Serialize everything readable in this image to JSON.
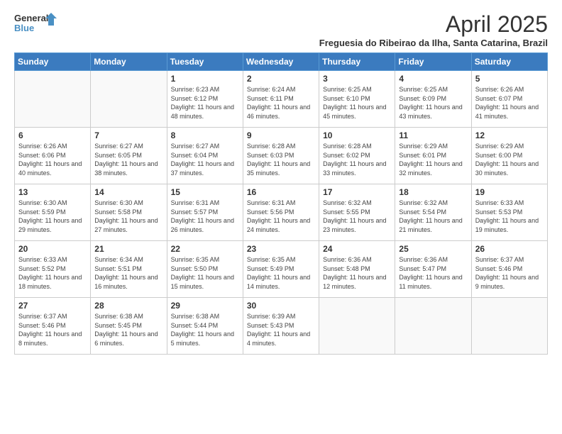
{
  "header": {
    "logo_line1": "General",
    "logo_line2": "Blue",
    "month_title": "April 2025",
    "subtitle": "Freguesia do Ribeirao da Ilha, Santa Catarina, Brazil"
  },
  "weekdays": [
    "Sunday",
    "Monday",
    "Tuesday",
    "Wednesday",
    "Thursday",
    "Friday",
    "Saturday"
  ],
  "weeks": [
    [
      {
        "day": "",
        "sunrise": "",
        "sunset": "",
        "daylight": ""
      },
      {
        "day": "",
        "sunrise": "",
        "sunset": "",
        "daylight": ""
      },
      {
        "day": "1",
        "sunrise": "Sunrise: 6:23 AM",
        "sunset": "Sunset: 6:12 PM",
        "daylight": "Daylight: 11 hours and 48 minutes."
      },
      {
        "day": "2",
        "sunrise": "Sunrise: 6:24 AM",
        "sunset": "Sunset: 6:11 PM",
        "daylight": "Daylight: 11 hours and 46 minutes."
      },
      {
        "day": "3",
        "sunrise": "Sunrise: 6:25 AM",
        "sunset": "Sunset: 6:10 PM",
        "daylight": "Daylight: 11 hours and 45 minutes."
      },
      {
        "day": "4",
        "sunrise": "Sunrise: 6:25 AM",
        "sunset": "Sunset: 6:09 PM",
        "daylight": "Daylight: 11 hours and 43 minutes."
      },
      {
        "day": "5",
        "sunrise": "Sunrise: 6:26 AM",
        "sunset": "Sunset: 6:07 PM",
        "daylight": "Daylight: 11 hours and 41 minutes."
      }
    ],
    [
      {
        "day": "6",
        "sunrise": "Sunrise: 6:26 AM",
        "sunset": "Sunset: 6:06 PM",
        "daylight": "Daylight: 11 hours and 40 minutes."
      },
      {
        "day": "7",
        "sunrise": "Sunrise: 6:27 AM",
        "sunset": "Sunset: 6:05 PM",
        "daylight": "Daylight: 11 hours and 38 minutes."
      },
      {
        "day": "8",
        "sunrise": "Sunrise: 6:27 AM",
        "sunset": "Sunset: 6:04 PM",
        "daylight": "Daylight: 11 hours and 37 minutes."
      },
      {
        "day": "9",
        "sunrise": "Sunrise: 6:28 AM",
        "sunset": "Sunset: 6:03 PM",
        "daylight": "Daylight: 11 hours and 35 minutes."
      },
      {
        "day": "10",
        "sunrise": "Sunrise: 6:28 AM",
        "sunset": "Sunset: 6:02 PM",
        "daylight": "Daylight: 11 hours and 33 minutes."
      },
      {
        "day": "11",
        "sunrise": "Sunrise: 6:29 AM",
        "sunset": "Sunset: 6:01 PM",
        "daylight": "Daylight: 11 hours and 32 minutes."
      },
      {
        "day": "12",
        "sunrise": "Sunrise: 6:29 AM",
        "sunset": "Sunset: 6:00 PM",
        "daylight": "Daylight: 11 hours and 30 minutes."
      }
    ],
    [
      {
        "day": "13",
        "sunrise": "Sunrise: 6:30 AM",
        "sunset": "Sunset: 5:59 PM",
        "daylight": "Daylight: 11 hours and 29 minutes."
      },
      {
        "day": "14",
        "sunrise": "Sunrise: 6:30 AM",
        "sunset": "Sunset: 5:58 PM",
        "daylight": "Daylight: 11 hours and 27 minutes."
      },
      {
        "day": "15",
        "sunrise": "Sunrise: 6:31 AM",
        "sunset": "Sunset: 5:57 PM",
        "daylight": "Daylight: 11 hours and 26 minutes."
      },
      {
        "day": "16",
        "sunrise": "Sunrise: 6:31 AM",
        "sunset": "Sunset: 5:56 PM",
        "daylight": "Daylight: 11 hours and 24 minutes."
      },
      {
        "day": "17",
        "sunrise": "Sunrise: 6:32 AM",
        "sunset": "Sunset: 5:55 PM",
        "daylight": "Daylight: 11 hours and 23 minutes."
      },
      {
        "day": "18",
        "sunrise": "Sunrise: 6:32 AM",
        "sunset": "Sunset: 5:54 PM",
        "daylight": "Daylight: 11 hours and 21 minutes."
      },
      {
        "day": "19",
        "sunrise": "Sunrise: 6:33 AM",
        "sunset": "Sunset: 5:53 PM",
        "daylight": "Daylight: 11 hours and 19 minutes."
      }
    ],
    [
      {
        "day": "20",
        "sunrise": "Sunrise: 6:33 AM",
        "sunset": "Sunset: 5:52 PM",
        "daylight": "Daylight: 11 hours and 18 minutes."
      },
      {
        "day": "21",
        "sunrise": "Sunrise: 6:34 AM",
        "sunset": "Sunset: 5:51 PM",
        "daylight": "Daylight: 11 hours and 16 minutes."
      },
      {
        "day": "22",
        "sunrise": "Sunrise: 6:35 AM",
        "sunset": "Sunset: 5:50 PM",
        "daylight": "Daylight: 11 hours and 15 minutes."
      },
      {
        "day": "23",
        "sunrise": "Sunrise: 6:35 AM",
        "sunset": "Sunset: 5:49 PM",
        "daylight": "Daylight: 11 hours and 14 minutes."
      },
      {
        "day": "24",
        "sunrise": "Sunrise: 6:36 AM",
        "sunset": "Sunset: 5:48 PM",
        "daylight": "Daylight: 11 hours and 12 minutes."
      },
      {
        "day": "25",
        "sunrise": "Sunrise: 6:36 AM",
        "sunset": "Sunset: 5:47 PM",
        "daylight": "Daylight: 11 hours and 11 minutes."
      },
      {
        "day": "26",
        "sunrise": "Sunrise: 6:37 AM",
        "sunset": "Sunset: 5:46 PM",
        "daylight": "Daylight: 11 hours and 9 minutes."
      }
    ],
    [
      {
        "day": "27",
        "sunrise": "Sunrise: 6:37 AM",
        "sunset": "Sunset: 5:46 PM",
        "daylight": "Daylight: 11 hours and 8 minutes."
      },
      {
        "day": "28",
        "sunrise": "Sunrise: 6:38 AM",
        "sunset": "Sunset: 5:45 PM",
        "daylight": "Daylight: 11 hours and 6 minutes."
      },
      {
        "day": "29",
        "sunrise": "Sunrise: 6:38 AM",
        "sunset": "Sunset: 5:44 PM",
        "daylight": "Daylight: 11 hours and 5 minutes."
      },
      {
        "day": "30",
        "sunrise": "Sunrise: 6:39 AM",
        "sunset": "Sunset: 5:43 PM",
        "daylight": "Daylight: 11 hours and 4 minutes."
      },
      {
        "day": "",
        "sunrise": "",
        "sunset": "",
        "daylight": ""
      },
      {
        "day": "",
        "sunrise": "",
        "sunset": "",
        "daylight": ""
      },
      {
        "day": "",
        "sunrise": "",
        "sunset": "",
        "daylight": ""
      }
    ]
  ]
}
